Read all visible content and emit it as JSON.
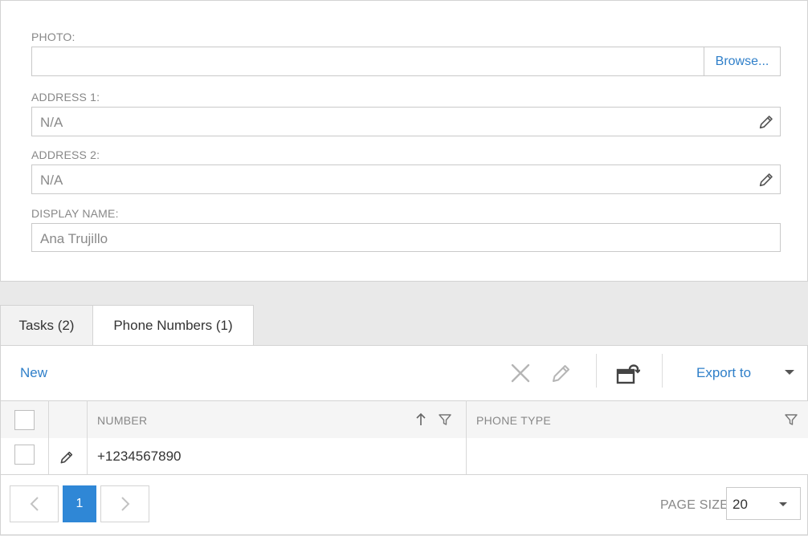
{
  "form": {
    "photo": {
      "label": "PHOTO:",
      "value": "",
      "browse_label": "Browse..."
    },
    "address1": {
      "label": "ADDRESS 1:",
      "value": "N/A"
    },
    "address2": {
      "label": "ADDRESS 2:",
      "value": "N/A"
    },
    "display_name": {
      "label": "DISPLAY NAME:",
      "value": "Ana Trujillo"
    }
  },
  "tabs": [
    {
      "label": "Tasks (2)",
      "active": false
    },
    {
      "label": "Phone Numbers (1)",
      "active": true
    }
  ],
  "toolbar": {
    "new_label": "New",
    "export_label": "Export to"
  },
  "grid": {
    "columns": [
      {
        "label": "NUMBER",
        "sort": "ascending"
      },
      {
        "label": "PHONE TYPE"
      }
    ],
    "rows": [
      {
        "number": "+1234567890",
        "phone_type": ""
      }
    ]
  },
  "pager": {
    "current_page": "1",
    "page_size_label": "PAGE SIZE",
    "page_size": "20"
  },
  "colors": {
    "accent": "#2f7fc9",
    "active_page": "#2f87d6",
    "muted_text": "#888888"
  }
}
